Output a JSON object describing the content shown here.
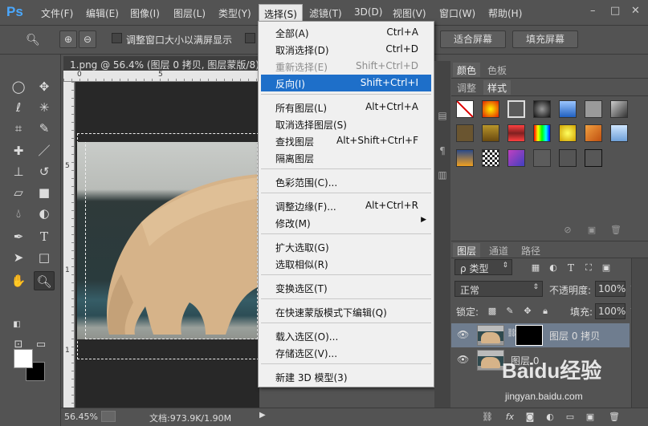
{
  "app": {
    "logo": "Ps"
  },
  "menubar": {
    "items": [
      {
        "label": "文件(F)"
      },
      {
        "label": "编辑(E)"
      },
      {
        "label": "图像(I)"
      },
      {
        "label": "图层(L)"
      },
      {
        "label": "类型(Y)"
      },
      {
        "label": "选择(S)"
      },
      {
        "label": "滤镜(T)"
      },
      {
        "label": "3D(D)"
      },
      {
        "label": "视图(V)"
      },
      {
        "label": "窗口(W)"
      },
      {
        "label": "帮助(H)"
      }
    ],
    "window_controls": [
      "–",
      "□",
      "✕"
    ]
  },
  "options": {
    "fit_checkbox_label": "调整窗口大小以满屏显示",
    "fit_screen": "适合屏幕",
    "fill_screen": "填充屏幕"
  },
  "document": {
    "tab_title": "1.png @ 56.4% (图层 0 拷贝, 图层蒙版/8) *",
    "ruler_h": [
      "0",
      "5"
    ],
    "ruler_v": [
      "5",
      "1",
      "1"
    ]
  },
  "select_menu": {
    "groups": [
      [
        {
          "label": "全部(A)",
          "shortcut": "Ctrl+A"
        },
        {
          "label": "取消选择(D)",
          "shortcut": "Ctrl+D"
        },
        {
          "label": "重新选择(E)",
          "shortcut": "Shift+Ctrl+D",
          "disabled": true
        },
        {
          "label": "反向(I)",
          "shortcut": "Shift+Ctrl+I",
          "highlighted": true
        }
      ],
      [
        {
          "label": "所有图层(L)",
          "shortcut": "Alt+Ctrl+A"
        },
        {
          "label": "取消选择图层(S)",
          "shortcut": ""
        },
        {
          "label": "查找图层",
          "shortcut": "Alt+Shift+Ctrl+F"
        },
        {
          "label": "隔离图层",
          "shortcut": ""
        }
      ],
      [
        {
          "label": "色彩范围(C)...",
          "shortcut": ""
        }
      ],
      [
        {
          "label": "调整边缘(F)...",
          "shortcut": "Alt+Ctrl+R"
        },
        {
          "label": "修改(M)",
          "shortcut": "",
          "submenu": true
        }
      ],
      [
        {
          "label": "扩大选取(G)",
          "shortcut": ""
        },
        {
          "label": "选取相似(R)",
          "shortcut": ""
        }
      ],
      [
        {
          "label": "变换选区(T)",
          "shortcut": ""
        }
      ],
      [
        {
          "label": "在快速蒙版模式下编辑(Q)",
          "shortcut": ""
        }
      ],
      [
        {
          "label": "载入选区(O)...",
          "shortcut": ""
        },
        {
          "label": "存储选区(V)...",
          "shortcut": ""
        }
      ],
      [
        {
          "label": "新建 3D 模型(3)",
          "shortcut": ""
        }
      ]
    ]
  },
  "color_panel": {
    "tabs": [
      "颜色",
      "色板"
    ]
  },
  "styles_panel": {
    "tabs": [
      "调整",
      "样式"
    ]
  },
  "layers_panel": {
    "tabs": [
      "图层",
      "通道",
      "路径"
    ],
    "kind_filter": "类型",
    "blend_mode": "正常",
    "opacity_label": "不透明度:",
    "opacity_value": "100%",
    "lock_label": "锁定:",
    "fill_label": "填充:",
    "fill_value": "100%",
    "layers": [
      {
        "name": "图层 0 拷贝",
        "selected": true
      },
      {
        "name": "图层 0",
        "selected": false
      }
    ]
  },
  "statusbar": {
    "zoom": "56.45%",
    "doc_info": "文档:973.9K/1.90M"
  },
  "watermark": {
    "text": "Baidu经验",
    "url": "jingyan.baidu.com"
  },
  "colors": {
    "ui_bg": "#535353",
    "menu_highlight": "#1e6fc9",
    "ps_blue": "#4aa8ff"
  }
}
